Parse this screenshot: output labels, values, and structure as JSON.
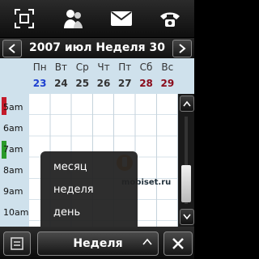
{
  "nav": {
    "title": "2007 июл Неделя 30"
  },
  "calendar": {
    "days": [
      "Пн",
      "Вт",
      "Ср",
      "Чт",
      "Пт",
      "Сб",
      "Вс"
    ],
    "dates": [
      "23",
      "24",
      "25",
      "26",
      "27",
      "28",
      "29"
    ],
    "hours": [
      "5am",
      "6am",
      "7am",
      "8am",
      "9am",
      "10am"
    ],
    "colors": {
      "today": "#1d3fd0",
      "weekend": "#8a0a1a",
      "event_red": "#c41a2a",
      "event_green": "#2a9a2a"
    }
  },
  "menu": {
    "items": [
      "месяц",
      "неделя",
      "день"
    ]
  },
  "watermark": {
    "text": "mobiset.ru"
  },
  "bottom": {
    "view_label": "Неделя"
  },
  "icons": {
    "top": [
      "scan-icon",
      "contacts-icon",
      "message-icon",
      "phone-icon"
    ],
    "bottom": [
      "menu-icon",
      "chevron-up-icon",
      "close-icon"
    ]
  }
}
